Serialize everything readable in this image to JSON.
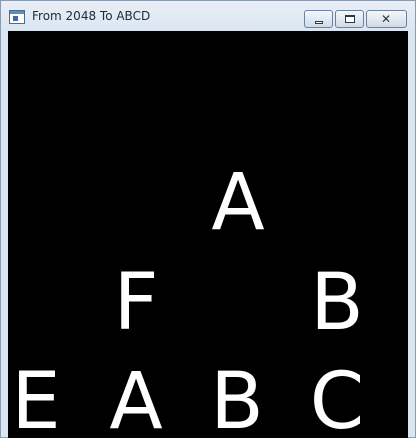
{
  "window": {
    "title": "From 2048 To ABCD",
    "icons": {
      "app": "app-window-icon",
      "minimize": "minimize-icon",
      "maximize": "maximize-icon",
      "close": "close-icon"
    },
    "close_glyph": "✕"
  },
  "board": {
    "background": "#000000",
    "tile_color": "#ffffff",
    "rows": [
      [
        "",
        "",
        "A",
        ""
      ],
      [
        "",
        "F",
        "",
        "B"
      ],
      [
        "E",
        "A",
        "B",
        "C"
      ]
    ]
  }
}
